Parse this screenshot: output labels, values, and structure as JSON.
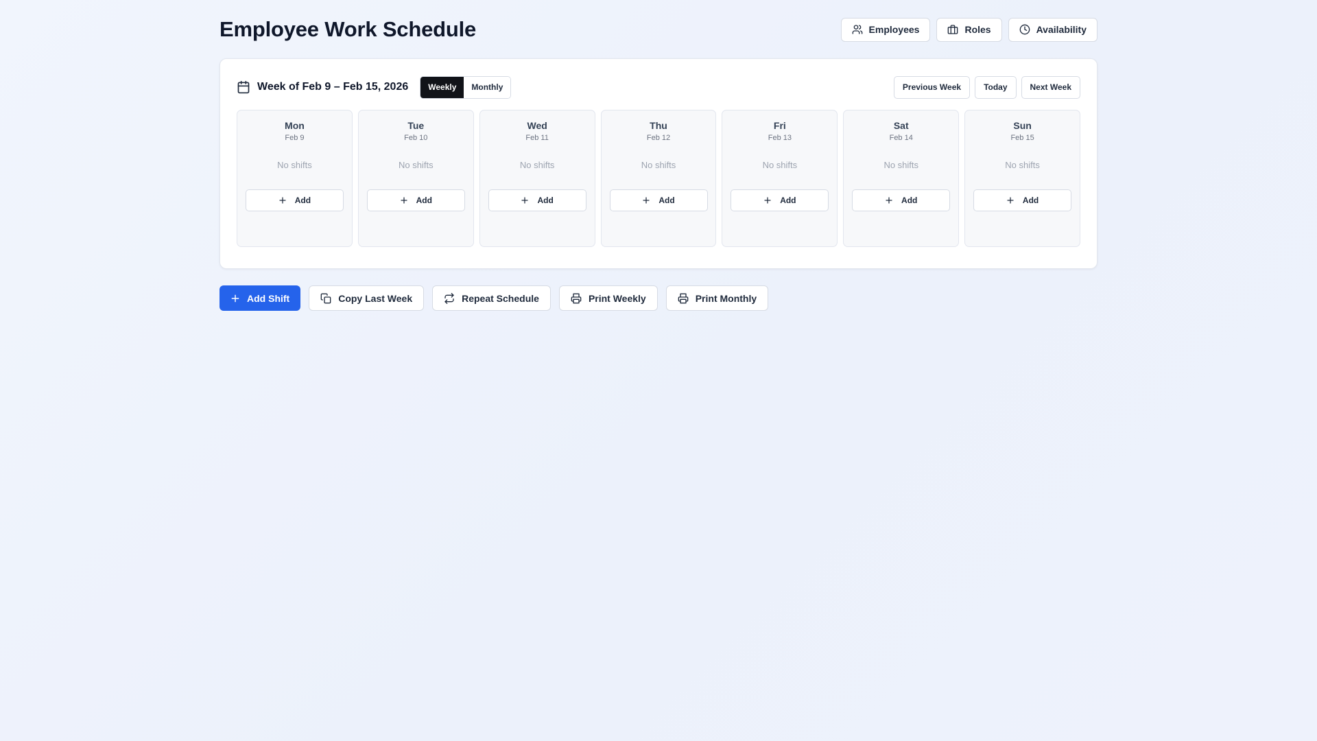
{
  "page": {
    "title": "Employee Work Schedule"
  },
  "header": {
    "buttons": [
      {
        "label": "Employees",
        "icon": "users-icon"
      },
      {
        "label": "Roles",
        "icon": "briefcase-icon"
      },
      {
        "label": "Availability",
        "icon": "clock-icon"
      }
    ]
  },
  "schedule": {
    "week_label": "Week of Feb 9 – Feb 15, 2026",
    "view_toggle": {
      "options": [
        "Weekly",
        "Monthly"
      ],
      "selected": "Weekly"
    },
    "nav": {
      "previous": "Previous Week",
      "today": "Today",
      "next": "Next Week"
    },
    "days": [
      {
        "name": "Mon",
        "date": "Feb 9",
        "empty_text": "No shifts",
        "add_label": "Add"
      },
      {
        "name": "Tue",
        "date": "Feb 10",
        "empty_text": "No shifts",
        "add_label": "Add"
      },
      {
        "name": "Wed",
        "date": "Feb 11",
        "empty_text": "No shifts",
        "add_label": "Add"
      },
      {
        "name": "Thu",
        "date": "Feb 12",
        "empty_text": "No shifts",
        "add_label": "Add"
      },
      {
        "name": "Fri",
        "date": "Feb 13",
        "empty_text": "No shifts",
        "add_label": "Add"
      },
      {
        "name": "Sat",
        "date": "Feb 14",
        "empty_text": "No shifts",
        "add_label": "Add"
      },
      {
        "name": "Sun",
        "date": "Feb 15",
        "empty_text": "No shifts",
        "add_label": "Add"
      }
    ]
  },
  "actions": {
    "add_shift": "Add Shift",
    "copy_last_week": "Copy Last Week",
    "repeat_schedule": "Repeat Schedule",
    "print_weekly": "Print Weekly",
    "print_monthly": "Print Monthly"
  },
  "colors": {
    "primary": "#2563eb",
    "toggle_active": "#111318",
    "background": "#eef2fb"
  }
}
